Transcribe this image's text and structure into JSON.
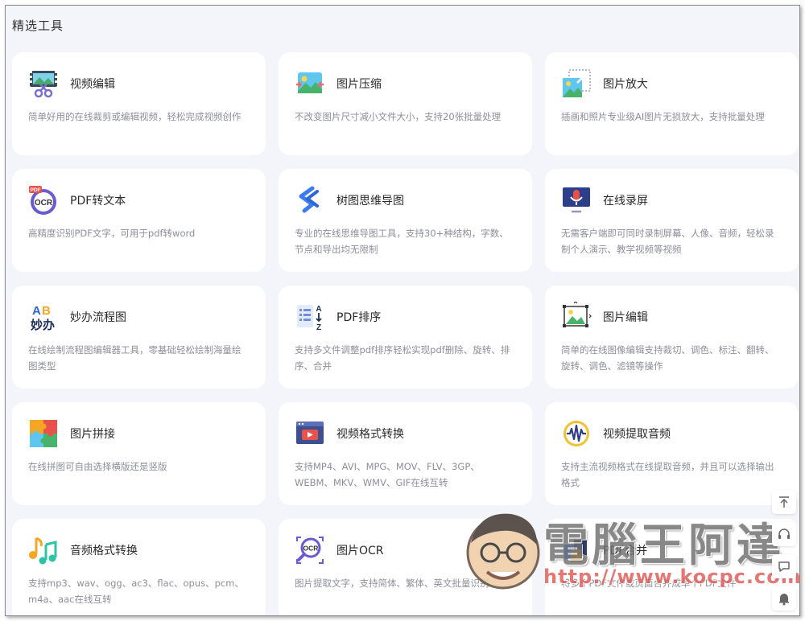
{
  "section": {
    "title": "精选工具"
  },
  "tools": [
    {
      "icon": "video-edit-icon",
      "title": "视频编辑",
      "desc": "简单好用的在线裁剪或编辑视频，轻松完成视频创作"
    },
    {
      "icon": "image-compress-icon",
      "title": "图片压缩",
      "desc": "不改变图片尺寸减小文件大小，支持20张批量处理"
    },
    {
      "icon": "image-enlarge-icon",
      "title": "图片放大",
      "desc": "插画和照片专业级AI图片无损放大，支持批量处理"
    },
    {
      "icon": "pdf-ocr-icon",
      "title": "PDF转文本",
      "desc": "高精度识别PDF文字，可用于pdf转word"
    },
    {
      "icon": "mindmap-icon",
      "title": "树图思维导图",
      "desc": "专业的在线思维导图工具，支持30+种结构，字数、节点和导出均无限制"
    },
    {
      "icon": "screen-record-icon",
      "title": "在线录屏",
      "desc": "无需客户端即可同时录制屏幕、人像、音频，轻松录制个人演示、教学视频等视频"
    },
    {
      "icon": "flowchart-icon",
      "title": "妙办流程图",
      "desc": "在线绘制流程图编辑器工具，零基础轻松绘制海量绘图类型"
    },
    {
      "icon": "pdf-sort-icon",
      "title": "PDF排序",
      "desc": "支持多文件调整pdf排序轻松实现pdf删除、旋转、排序、合并"
    },
    {
      "icon": "image-editor-icon",
      "title": "图片编辑",
      "desc": "简单的在线图像编辑支持裁切、调色、标注、翻转、旋转、调色、滤镜等操作"
    },
    {
      "icon": "puzzle-icon",
      "title": "图片拼接",
      "desc": "在线拼图可自由选择横版还是竖版"
    },
    {
      "icon": "video-convert-icon",
      "title": "视频格式转换",
      "desc": "支持MP4、AVI、MPG、MOV、FLV、3GP、WEBM、MKV、WMV、GIF在线互转"
    },
    {
      "icon": "audio-extract-icon",
      "title": "视频提取音频",
      "desc": "支持主流视频格式在线提取音频，并且可以选择输出格式"
    },
    {
      "icon": "music-note-icon",
      "title": "音频格式转换",
      "desc": "支持mp3、wav、ogg、ac3、flac、opus、pcm、m4a、aac在线互转"
    },
    {
      "icon": "image-ocr-icon",
      "title": "图片OCR",
      "desc": "图片提取文字，支持简体、繁体、英文批量识别"
    },
    {
      "icon": "pdf-merge-icon",
      "title": "PDF合并",
      "desc": "将多个PDF文件或页面合并成单个PDF文件"
    }
  ],
  "sidebar": {
    "buttons": [
      {
        "icon": "back-to-top-icon"
      },
      {
        "icon": "headset-icon"
      },
      {
        "icon": "chat-icon"
      },
      {
        "icon": "bell-icon"
      }
    ]
  },
  "watermark": {
    "title": "電腦王阿達",
    "url": "http://www.kocpc.com.tw"
  },
  "colors": {
    "page_bg": "#f4f5fa",
    "card_bg": "#ffffff",
    "title": "#2a2a2a",
    "desc": "#8d8f98"
  }
}
